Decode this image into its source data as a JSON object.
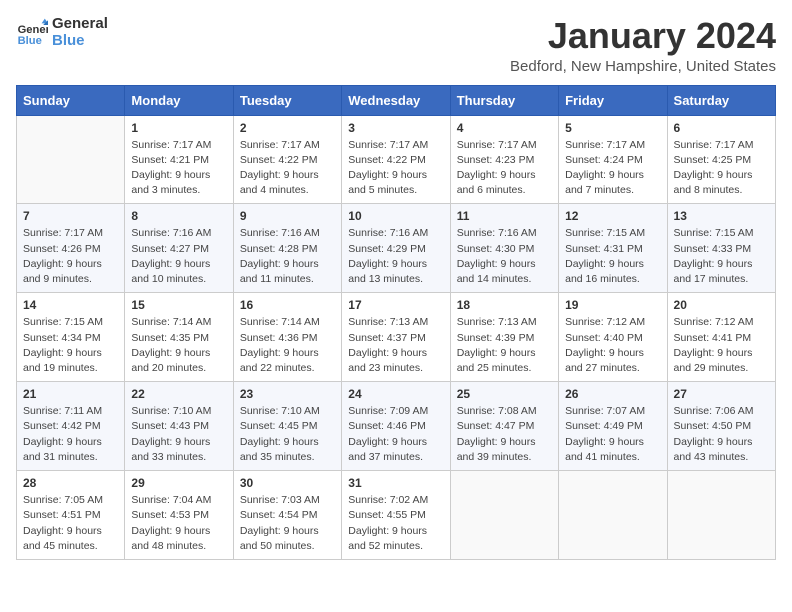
{
  "logo": {
    "line1": "General",
    "line2": "Blue"
  },
  "title": "January 2024",
  "subtitle": "Bedford, New Hampshire, United States",
  "header": {
    "accent_color": "#3a6abf"
  },
  "weekdays": [
    "Sunday",
    "Monday",
    "Tuesday",
    "Wednesday",
    "Thursday",
    "Friday",
    "Saturday"
  ],
  "weeks": [
    [
      {
        "num": "",
        "sunrise": "",
        "sunset": "",
        "daylight": ""
      },
      {
        "num": "1",
        "sunrise": "Sunrise: 7:17 AM",
        "sunset": "Sunset: 4:21 PM",
        "daylight": "Daylight: 9 hours and 3 minutes."
      },
      {
        "num": "2",
        "sunrise": "Sunrise: 7:17 AM",
        "sunset": "Sunset: 4:22 PM",
        "daylight": "Daylight: 9 hours and 4 minutes."
      },
      {
        "num": "3",
        "sunrise": "Sunrise: 7:17 AM",
        "sunset": "Sunset: 4:22 PM",
        "daylight": "Daylight: 9 hours and 5 minutes."
      },
      {
        "num": "4",
        "sunrise": "Sunrise: 7:17 AM",
        "sunset": "Sunset: 4:23 PM",
        "daylight": "Daylight: 9 hours and 6 minutes."
      },
      {
        "num": "5",
        "sunrise": "Sunrise: 7:17 AM",
        "sunset": "Sunset: 4:24 PM",
        "daylight": "Daylight: 9 hours and 7 minutes."
      },
      {
        "num": "6",
        "sunrise": "Sunrise: 7:17 AM",
        "sunset": "Sunset: 4:25 PM",
        "daylight": "Daylight: 9 hours and 8 minutes."
      }
    ],
    [
      {
        "num": "7",
        "sunrise": "Sunrise: 7:17 AM",
        "sunset": "Sunset: 4:26 PM",
        "daylight": "Daylight: 9 hours and 9 minutes."
      },
      {
        "num": "8",
        "sunrise": "Sunrise: 7:16 AM",
        "sunset": "Sunset: 4:27 PM",
        "daylight": "Daylight: 9 hours and 10 minutes."
      },
      {
        "num": "9",
        "sunrise": "Sunrise: 7:16 AM",
        "sunset": "Sunset: 4:28 PM",
        "daylight": "Daylight: 9 hours and 11 minutes."
      },
      {
        "num": "10",
        "sunrise": "Sunrise: 7:16 AM",
        "sunset": "Sunset: 4:29 PM",
        "daylight": "Daylight: 9 hours and 13 minutes."
      },
      {
        "num": "11",
        "sunrise": "Sunrise: 7:16 AM",
        "sunset": "Sunset: 4:30 PM",
        "daylight": "Daylight: 9 hours and 14 minutes."
      },
      {
        "num": "12",
        "sunrise": "Sunrise: 7:15 AM",
        "sunset": "Sunset: 4:31 PM",
        "daylight": "Daylight: 9 hours and 16 minutes."
      },
      {
        "num": "13",
        "sunrise": "Sunrise: 7:15 AM",
        "sunset": "Sunset: 4:33 PM",
        "daylight": "Daylight: 9 hours and 17 minutes."
      }
    ],
    [
      {
        "num": "14",
        "sunrise": "Sunrise: 7:15 AM",
        "sunset": "Sunset: 4:34 PM",
        "daylight": "Daylight: 9 hours and 19 minutes."
      },
      {
        "num": "15",
        "sunrise": "Sunrise: 7:14 AM",
        "sunset": "Sunset: 4:35 PM",
        "daylight": "Daylight: 9 hours and 20 minutes."
      },
      {
        "num": "16",
        "sunrise": "Sunrise: 7:14 AM",
        "sunset": "Sunset: 4:36 PM",
        "daylight": "Daylight: 9 hours and 22 minutes."
      },
      {
        "num": "17",
        "sunrise": "Sunrise: 7:13 AM",
        "sunset": "Sunset: 4:37 PM",
        "daylight": "Daylight: 9 hours and 23 minutes."
      },
      {
        "num": "18",
        "sunrise": "Sunrise: 7:13 AM",
        "sunset": "Sunset: 4:39 PM",
        "daylight": "Daylight: 9 hours and 25 minutes."
      },
      {
        "num": "19",
        "sunrise": "Sunrise: 7:12 AM",
        "sunset": "Sunset: 4:40 PM",
        "daylight": "Daylight: 9 hours and 27 minutes."
      },
      {
        "num": "20",
        "sunrise": "Sunrise: 7:12 AM",
        "sunset": "Sunset: 4:41 PM",
        "daylight": "Daylight: 9 hours and 29 minutes."
      }
    ],
    [
      {
        "num": "21",
        "sunrise": "Sunrise: 7:11 AM",
        "sunset": "Sunset: 4:42 PM",
        "daylight": "Daylight: 9 hours and 31 minutes."
      },
      {
        "num": "22",
        "sunrise": "Sunrise: 7:10 AM",
        "sunset": "Sunset: 4:43 PM",
        "daylight": "Daylight: 9 hours and 33 minutes."
      },
      {
        "num": "23",
        "sunrise": "Sunrise: 7:10 AM",
        "sunset": "Sunset: 4:45 PM",
        "daylight": "Daylight: 9 hours and 35 minutes."
      },
      {
        "num": "24",
        "sunrise": "Sunrise: 7:09 AM",
        "sunset": "Sunset: 4:46 PM",
        "daylight": "Daylight: 9 hours and 37 minutes."
      },
      {
        "num": "25",
        "sunrise": "Sunrise: 7:08 AM",
        "sunset": "Sunset: 4:47 PM",
        "daylight": "Daylight: 9 hours and 39 minutes."
      },
      {
        "num": "26",
        "sunrise": "Sunrise: 7:07 AM",
        "sunset": "Sunset: 4:49 PM",
        "daylight": "Daylight: 9 hours and 41 minutes."
      },
      {
        "num": "27",
        "sunrise": "Sunrise: 7:06 AM",
        "sunset": "Sunset: 4:50 PM",
        "daylight": "Daylight: 9 hours and 43 minutes."
      }
    ],
    [
      {
        "num": "28",
        "sunrise": "Sunrise: 7:05 AM",
        "sunset": "Sunset: 4:51 PM",
        "daylight": "Daylight: 9 hours and 45 minutes."
      },
      {
        "num": "29",
        "sunrise": "Sunrise: 7:04 AM",
        "sunset": "Sunset: 4:53 PM",
        "daylight": "Daylight: 9 hours and 48 minutes."
      },
      {
        "num": "30",
        "sunrise": "Sunrise: 7:03 AM",
        "sunset": "Sunset: 4:54 PM",
        "daylight": "Daylight: 9 hours and 50 minutes."
      },
      {
        "num": "31",
        "sunrise": "Sunrise: 7:02 AM",
        "sunset": "Sunset: 4:55 PM",
        "daylight": "Daylight: 9 hours and 52 minutes."
      },
      {
        "num": "",
        "sunrise": "",
        "sunset": "",
        "daylight": ""
      },
      {
        "num": "",
        "sunrise": "",
        "sunset": "",
        "daylight": ""
      },
      {
        "num": "",
        "sunrise": "",
        "sunset": "",
        "daylight": ""
      }
    ]
  ]
}
